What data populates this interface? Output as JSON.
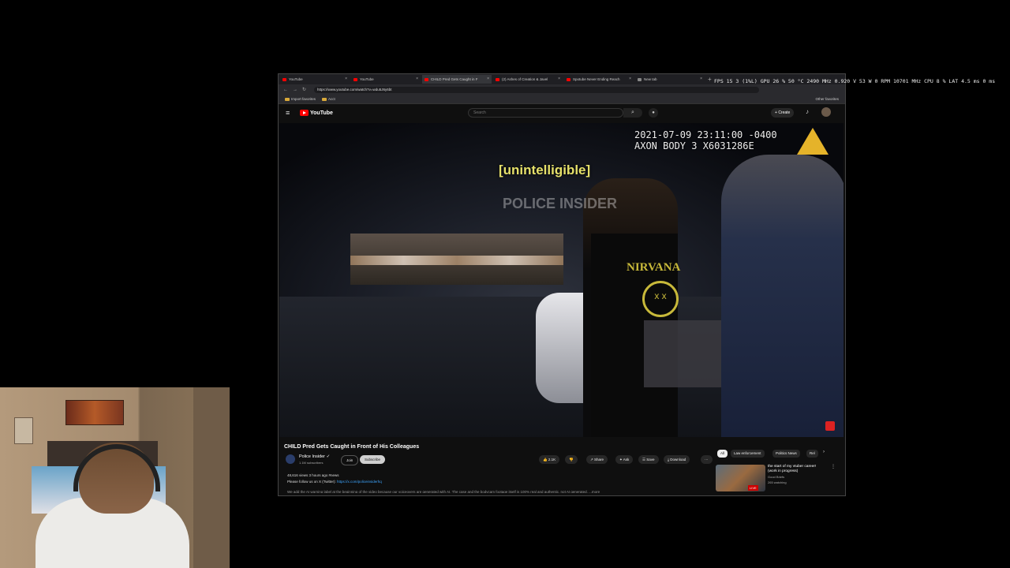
{
  "browser": {
    "tabs": [
      {
        "label": "YouTube",
        "favicon": "youtube-icon"
      },
      {
        "label": "YouTube",
        "favicon": "youtube-icon"
      },
      {
        "label": "CHILD Pred Gets Caught in F",
        "favicon": "youtube-icon"
      },
      {
        "label": "(2) Ashes of Creation & Javel",
        "favicon": "youtube-icon"
      },
      {
        "label": "Spotube Never Ending Reach",
        "favicon": "youtube-icon"
      },
      {
        "label": "New tab",
        "favicon": "blank-page-icon"
      }
    ],
    "url": "https://www.youtube.com/watch?v=wdu5J6y6bt",
    "bookmarks": [
      "Import favorites",
      "Acct"
    ],
    "other_bookmarks": "Other favorites"
  },
  "youtube": {
    "logo": "YouTube",
    "search_placeholder": "Search",
    "create_label": "Create"
  },
  "video": {
    "timestamp_line1": "2021-07-09 23:11:00 -0400",
    "timestamp_line2": "AXON BODY 3 X6031286E",
    "caption": "[unintelligible]",
    "watermark": "POLICE INSIDER",
    "shirt_text": "NIRVANA",
    "smiley": "x x"
  },
  "details": {
    "title": "CHILD Pred Gets Caught in Front of His Colleagues",
    "channel_name": "Police Insider",
    "subscribers": "1.1M subscribers",
    "join_label": "Join",
    "subscribe_label": "Subscribe",
    "likes": "2.1K",
    "share_label": "Share",
    "ask_label": "Ask",
    "save_label": "Save",
    "download_label": "Download",
    "views_line": "48,616 views  3 hours ago  #news",
    "follow_text": "Please follow us on X (Twitter): ",
    "follow_link": "https://x.com/policeinsiderhq",
    "description": "We add the AI warning label at the beginning of the video because our voiceovers are generated with AI. The case and the bodycam footage itself is 100% real and authentic, not AI generated. ...more"
  },
  "chips": [
    "All",
    "Law enforcement",
    "Politics News",
    "Rel"
  ],
  "recommendation": {
    "title": "the start of my vtuber career! (work in progress)",
    "channel": "Good Briefs",
    "watching": "265 watching",
    "live_badge": "LIVE"
  },
  "overlay": {
    "text": "FPS  15  3 (1%L)   GPU  26 %  50 °C  2490 MHz  0.920 V  53 W  0 RPM  10701 MHz    CPU  8 %    LAT  4.5 ms  0 ms"
  }
}
